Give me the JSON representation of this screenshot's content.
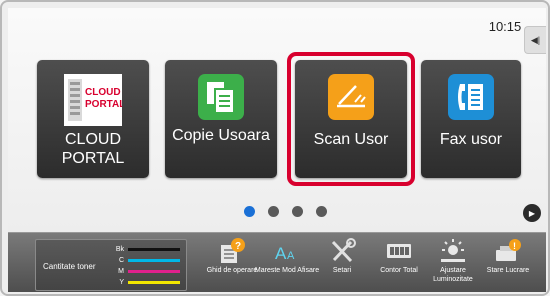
{
  "status": {
    "time": "10:15"
  },
  "apps": [
    {
      "label": "CLOUD PORTAL",
      "icon": "cloud-portal-icon",
      "icon_text": [
        "CLOUD",
        "PORTAL"
      ]
    },
    {
      "label": "Copie Usoara",
      "icon": "copy-icon"
    },
    {
      "label": "Scan Usor",
      "icon": "scan-icon",
      "selected": true
    },
    {
      "label": "Fax usor",
      "icon": "fax-icon"
    }
  ],
  "pager": {
    "pages": 4,
    "current": 1
  },
  "toner": {
    "title": "Cantitate toner",
    "channels": [
      {
        "name": "Bk",
        "color": "#111111",
        "level": 1.0
      },
      {
        "name": "C",
        "color": "#00b8e6",
        "level": 1.0
      },
      {
        "name": "M",
        "color": "#e0208c",
        "level": 1.0
      },
      {
        "name": "Y",
        "color": "#f2e600",
        "level": 1.0
      }
    ]
  },
  "tools": [
    {
      "label": "Ghid de operare",
      "icon": "operation-guide-icon"
    },
    {
      "label": "Mareste Mod Afisare",
      "icon": "enlarge-display-icon"
    },
    {
      "label": "Setari",
      "icon": "settings-icon"
    },
    {
      "label": "Contor Total",
      "icon": "total-count-icon"
    },
    {
      "label": "Ajustare Luminozitate",
      "icon": "brightness-icon"
    },
    {
      "label": "Stare Lucrare",
      "icon": "job-status-icon"
    }
  ],
  "colors": {
    "selection": "#d8002e",
    "active_dot": "#1a70d6",
    "tile": "#3a3a3a"
  }
}
